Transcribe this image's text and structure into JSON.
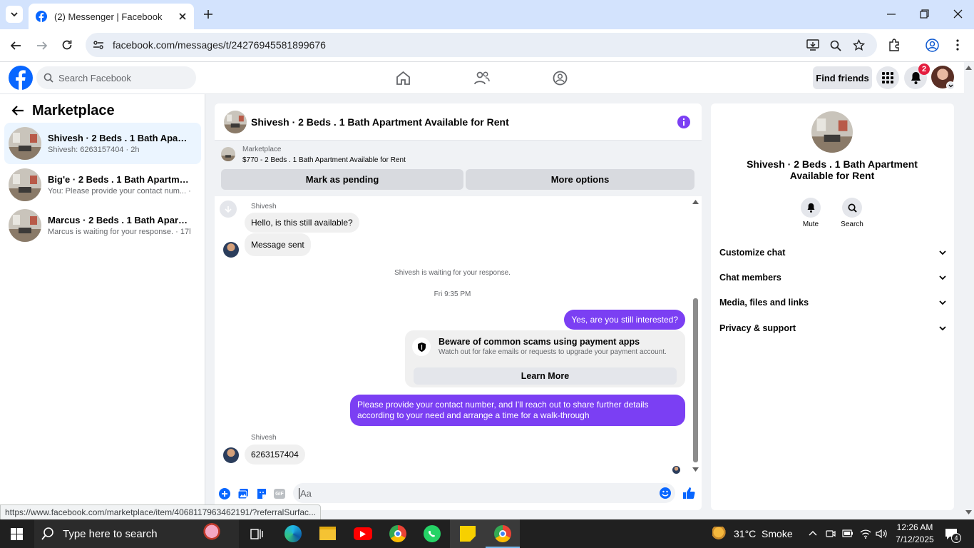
{
  "browser": {
    "tab_title": "(2) Messenger | Facebook",
    "url": "facebook.com/messages/t/24276945581899676",
    "status_url": "https://www.facebook.com/marketplace/item/4068117963462191/?referralSurfac..."
  },
  "header": {
    "search_placeholder": "Search Facebook",
    "find_friends": "Find friends",
    "notification_count": "2"
  },
  "sidebar": {
    "title": "Marketplace",
    "conversations": [
      {
        "title": "Shivesh · 2 Beds . 1 Bath Apartmen...",
        "subtitle": "Shivesh: 6263157404 · 2h"
      },
      {
        "title": "Big'e · 2 Beds . 1 Bath Apartment A...",
        "subtitle": "You: Please provide your contact num... · 2h"
      },
      {
        "title": "Marcus · 2 Beds . 1 Bath Apartmen...",
        "subtitle": "Marcus is waiting for your response. · 17h"
      }
    ]
  },
  "chat": {
    "title": "Shivesh · 2 Beds . 1 Bath Apartment Available for Rent",
    "listing_label": "Marketplace",
    "listing_detail": "$770 - 2 Beds . 1 Bath Apartment Available for Rent",
    "mark_pending": "Mark as pending",
    "more_options": "More options",
    "sender1": "Shivesh",
    "msg1": "Hello, is this still available?",
    "msg2": "Message sent",
    "waiting": "Shivesh is waiting for your response.",
    "timestamp": "Fri 9:35 PM",
    "out1": "Yes, are you still interested?",
    "scam_title": "Beware of common scams using payment apps",
    "scam_text": "Watch out for fake emails or requests to upgrade your payment account.",
    "learn_more": "Learn More",
    "out2": "Please provide your contact number, and I'll reach out to share further details according to your need and arrange a time for a walk-through",
    "sender2": "Shivesh",
    "msg3": "6263157404",
    "input_placeholder": "Aa",
    "accent": "#7b3ff3"
  },
  "rightpanel": {
    "title": "Shivesh · 2 Beds . 1 Bath Apartment Available for Rent",
    "mute": "Mute",
    "search": "Search",
    "items": [
      "Customize chat",
      "Chat members",
      "Media, files and links",
      "Privacy & support"
    ]
  },
  "taskbar": {
    "search_text": "Type here to search",
    "weather": "31°C  Smoke",
    "time": "12:26 AM",
    "date": "7/12/2025",
    "notif_count": "4"
  }
}
